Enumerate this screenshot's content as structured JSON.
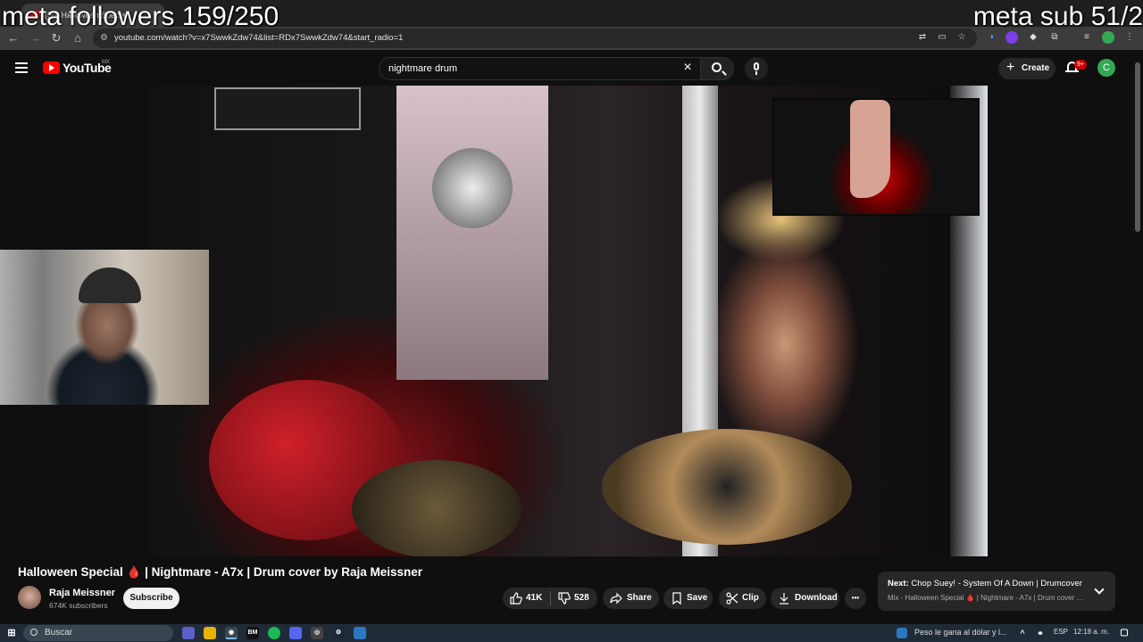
{
  "overlay": {
    "left_text": "meta followers 159/250",
    "right_text": "meta sub 51/2"
  },
  "browser": {
    "tab_title": "(50) Halloween Special",
    "url": "youtube.com/watch?v=x7SwwkZdw74&list=RDx7SwwkZdw74&start_radio=1"
  },
  "header": {
    "logo_text": "YouTube",
    "country_code": "MX",
    "search_value": "nightmare drum",
    "create_label": "Create",
    "notification_badge": "9+",
    "avatar_letter": "C"
  },
  "video": {
    "title": "Halloween Special 🩸 | Nightmare - A7x | Drum cover by Raja Meissner",
    "channel_name": "Raja Meissner",
    "subscriber_count": "674K subscribers",
    "subscribe_label": "Subscribe",
    "likes": "41K",
    "dislikes": "528",
    "share_label": "Share",
    "save_label": "Save",
    "clip_label": "Clip",
    "download_label": "Download",
    "more_label": "•••"
  },
  "up_next": {
    "prefix": "Next:",
    "title": "Chop Suey! - System Of A Down | Drumcover",
    "subtitle": "Mix - Halloween Special 🩸 | Nightmare - A7x | Drum cover b..."
  },
  "taskbar": {
    "search_placeholder": "Buscar",
    "news": "Peso le gana al dólar y l...",
    "language": "ESP",
    "time": "12:18 a. m."
  },
  "colors": {
    "youtube_red": "#ff0000",
    "background": "#0f0f0f",
    "pill": "#272727",
    "avatar": "#34a853"
  }
}
